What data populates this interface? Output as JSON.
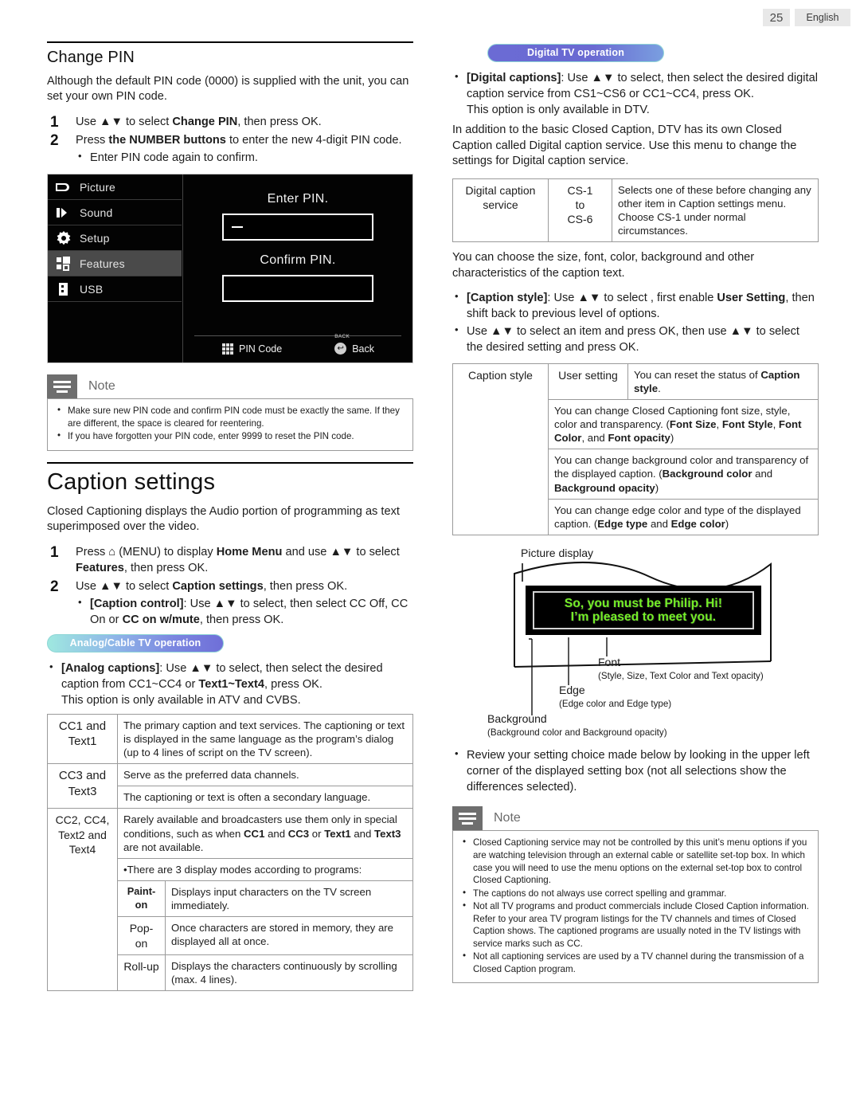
{
  "header": {
    "page_number": "25",
    "language": "English"
  },
  "left": {
    "change_pin": {
      "title": "Change PIN",
      "intro": "Although the default PIN code (0000) is supplied with the unit, you can set your own PIN code.",
      "step1_pre": "Use ",
      "step1_arrows": "▲▼",
      "step1_mid": " to select ",
      "step1_bold": "Change PIN",
      "step1_post": ", then press OK.",
      "step1_num": "1",
      "step2_num": "2",
      "step2_pre": "Press ",
      "step2_bold": "the NUMBER buttons",
      "step2_post": " to enter the new 4-digit PIN code.",
      "step2_bullet": "Enter PIN code again to confirm."
    },
    "tv_menu": {
      "items": [
        {
          "label": "Picture",
          "icon": "picture-icon",
          "selected": false
        },
        {
          "label": "Sound",
          "icon": "speaker-icon",
          "selected": false
        },
        {
          "label": "Setup",
          "icon": "gear-icon",
          "selected": false
        },
        {
          "label": "Features",
          "icon": "features-icon",
          "selected": true
        },
        {
          "label": "USB",
          "icon": "usb-icon",
          "selected": false
        }
      ],
      "enter_prompt": "Enter PIN.",
      "enter_value": "–",
      "confirm_prompt": "Confirm PIN.",
      "confirm_value": "",
      "foot_pin_label": "PIN Code",
      "foot_back_tag": "BACK",
      "foot_back_label": "Back",
      "foot_back_glyph": "↩"
    },
    "note1": {
      "title": "Note",
      "items": [
        "Make sure new PIN code and confirm PIN code must be exactly the same. If they are different, the space is cleared for reentering.",
        "If you have forgotten your PIN code, enter 9999 to reset the PIN code."
      ]
    },
    "caption_settings": {
      "title": "Caption settings",
      "intro": "Closed Captioning displays the Audio portion of programming as text superimposed over the video.",
      "step1_num": "1",
      "step1_a": "Press ",
      "step1_home": "⌂",
      "step1_b": " (MENU) to display ",
      "step1_c": "Home Menu",
      "step1_d": " and use ",
      "step1_arrows": "▲▼",
      "step1_e": " to select ",
      "step1_f": "Features",
      "step1_g": ", then press OK.",
      "step2_num": "2",
      "step2_a": "Use ",
      "step2_arrows": "▲▼",
      "step2_b": " to select ",
      "step2_c": "Caption settings",
      "step2_d": ", then press OK.",
      "bullet_a": "[Caption control]",
      "bullet_b": ": Use ",
      "bullet_arrows": "▲▼",
      "bullet_c": " to select, then select ",
      "bullet_d": "CC Off",
      "bullet_e": ", ",
      "bullet_f": "CC On",
      "bullet_g": " or ",
      "bullet_h": "CC on w/mute",
      "bullet_i": ", then press OK."
    },
    "analog_pill": "Analog/Cable TV operation",
    "analog_bullet": {
      "a": "[Analog captions]",
      "b": ": Use ",
      "arrows": "▲▼",
      "c": " to select, then select the desired caption from ",
      "d": "CC1~CC4",
      "e": " or ",
      "f": "Text1~Text4",
      "g": ", press OK.",
      "h": "This option is only available in ATV and CVBS."
    },
    "cc_table": [
      {
        "key_line1": "CC1",
        "key_and": " and",
        "key_line2": "Text1",
        "desc": "The primary caption and text services. The captioning or text is displayed in the same language as the program’s dialog (up to 4 lines of script on the TV screen)."
      },
      {
        "key_line1": "CC3",
        "key_and": " and",
        "key_line2": "Text3",
        "desc_a": "Serve as the preferred data channels.",
        "desc_b": "The captioning or text is often a secondary language."
      },
      {
        "key_line1": "CC2, CC4,",
        "key_line2": "Text2 and",
        "key_line3": "Text4",
        "desc_a": "Rarely available and broadcasters use them only in special conditions, such as when ",
        "desc_a_b1": "CC1",
        "desc_a_m1": " and ",
        "desc_a_b2": "CC3",
        "desc_a_m2": " or ",
        "desc_a_b3": "Text1",
        "desc_a_m3": " and ",
        "desc_a_b4": "Text3",
        "desc_a_end": " are not available.",
        "desc_b": "•There are 3 display modes according to programs:",
        "modes": [
          {
            "name": "Paint-on",
            "desc": "Displays input characters on the TV screen immediately."
          },
          {
            "name": "Pop-on",
            "desc": "Once characters are stored in memory, they are displayed all at once."
          },
          {
            "name": "Roll-up",
            "desc": "Displays the characters continuously by scrolling (max. 4 lines)."
          }
        ]
      }
    ]
  },
  "right": {
    "digital_pill": "Digital TV operation",
    "digital_bullet": {
      "a": "[Digital captions]",
      "b": ": Use ",
      "arrows": "▲▼",
      "c": " to select, then select the desired digital caption service from ",
      "d": "CS1~CS6",
      "e": " or ",
      "f": "CC1~CC4",
      "g": ", press OK.",
      "h": "This option is only available in DTV."
    },
    "digital_para": "In addition to the basic Closed Caption, DTV has its own Closed Caption called Digital caption service. Use this menu to change the settings for Digital caption service.",
    "dcs_table": {
      "label": "Digital caption service",
      "range_line1": "CS-1",
      "range_line2": "to",
      "range_line3": "CS-6",
      "desc": "Selects one of these before changing any other item in Caption settings menu. Choose CS-1 under normal circumstances."
    },
    "choose_para": "You can choose the size, font, color, background and other characteristics of the caption text.",
    "style_bullets": {
      "b1_a": "[Caption style]",
      "b1_b": ": Use ",
      "b1_arrows": "▲▼",
      "b1_c": " to select , first enable ",
      "b1_d": "User Setting",
      "b1_e": ", then shift back to previous level of options.",
      "b2_a": "Use ",
      "b2_arrows": "▲▼",
      "b2_b": " to select an item and press OK, then use ",
      "b2_c": " to select the desired setting and press OK."
    },
    "caption_style_table": {
      "label": "Caption style",
      "user_setting_key": "User setting",
      "user_setting_desc_a": "You can reset the status of ",
      "user_setting_desc_b": "Caption style",
      "user_setting_desc_c": ".",
      "row2_a": "You can change Closed Captioning font size, style, color and transparency. (",
      "row2_b1": "Font Size",
      "row2_b2": "Font Style",
      "row2_b3": "Font Color",
      "row2_b4": "Font opacity",
      "row3_a": "You can change background color and transparency of the displayed caption. (",
      "row3_b1": "Background color",
      "row3_b2": "Background opacity",
      "row4_a": "You can change edge color and type of the displayed caption. (",
      "row4_b1": "Edge type",
      "row4_b2": "Edge color"
    },
    "diagram": {
      "picture_display": "Picture display",
      "caption_line1": "So, you must be Philip. Hi!",
      "caption_line2": "I’m pleased to meet you.",
      "font_label": "Font",
      "font_sub": "(Style, Size, Text Color and Text opacity)",
      "edge_label": "Edge",
      "edge_sub": "(Edge color and Edge type)",
      "background_label": "Background",
      "background_sub": "(Background color and Background opacity)",
      "caption_text_color": "#74ef27"
    },
    "review_bullet": "Review your setting choice made below by looking in the upper left corner of the displayed setting box (not all selections show the differences selected).",
    "note2": {
      "title": "Note",
      "items": [
        "Closed Captioning service may not be controlled by this unit’s menu options if you are watching television through an external cable or satellite set-top box. In which case you will need to use the menu options on the external set-top box to control Closed Captioning.",
        "The captions do not always use correct spelling and grammar.",
        "Not all TV programs and product commercials include Closed Caption information. Refer to your area TV program listings for the TV channels and times of Closed Caption shows. The captioned programs are usually noted in the TV listings with service marks such as CC.",
        "Not all captioning services are used by a TV channel during the transmission of a Closed Caption program."
      ]
    }
  }
}
